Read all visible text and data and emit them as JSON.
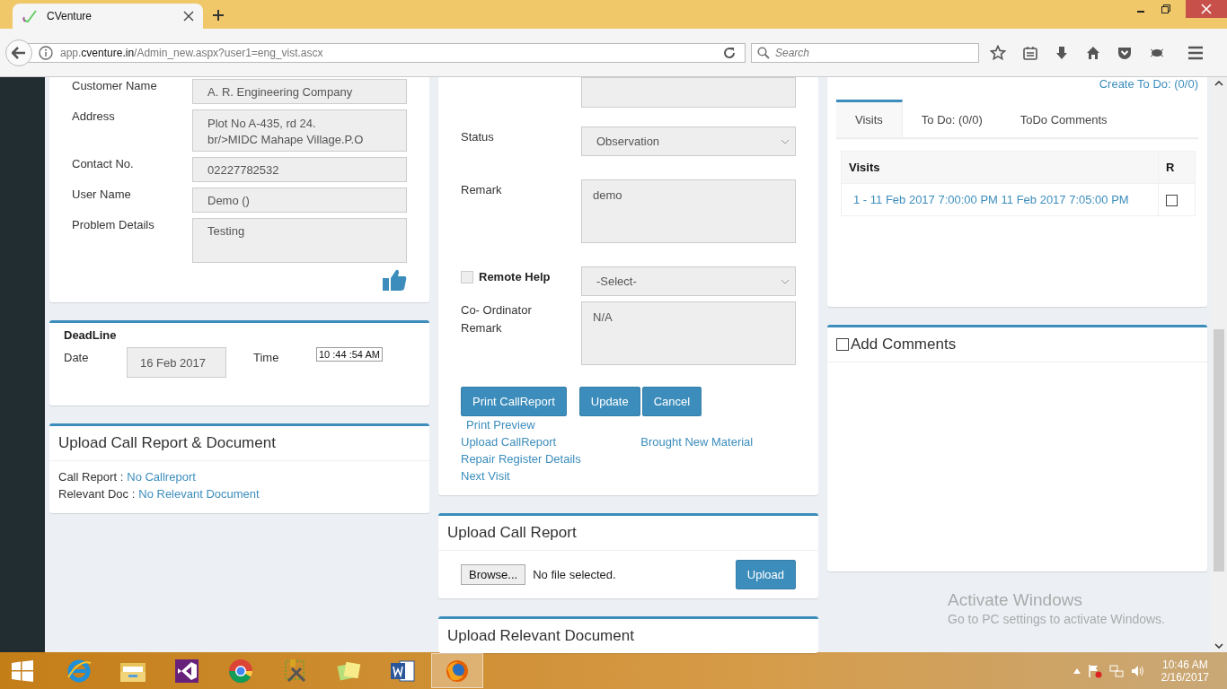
{
  "browser": {
    "tab_title": "CVenture",
    "url": {
      "prefix": "app.",
      "host": "cventure.in",
      "path": "/Admin_new.aspx?user1=eng_vist.ascx"
    },
    "search_placeholder": "Search"
  },
  "customer_card": {
    "fields": [
      {
        "kind": "input",
        "label": "Customer Name",
        "value": "A. R. Engineering Company"
      },
      {
        "kind": "scrolltext",
        "label": "Address",
        "lines": [
          "Plot No A-435, rd 24.",
          "br/>MIDC Mahape Village.P.O"
        ]
      },
      {
        "kind": "input",
        "label": "Contact No.",
        "value": "02227782532"
      },
      {
        "kind": "input",
        "label": "User Name",
        "value": "Demo ()"
      },
      {
        "kind": "textarea",
        "label": "Problem Details",
        "value": "Testing"
      }
    ]
  },
  "deadline": {
    "title": "DeadLine",
    "date_label": "Date",
    "date": "16 Feb 2017",
    "time_label": "Time",
    "time": "10 :44 :54  AM"
  },
  "upload_doc": {
    "title": "Upload Call Report & Document",
    "rows": [
      {
        "label": "Call Report :",
        "link": "No Callreport"
      },
      {
        "label": "Relevant Doc :",
        "link": "No Relevant Document"
      }
    ]
  },
  "visit_form": {
    "status_label": "Status",
    "status": "Observation",
    "remark_label": "Remark",
    "remark": "demo",
    "remote_help": {
      "label": "Remote Help",
      "checked": false
    },
    "remote_select": "-Select-",
    "coordinator_label": "Co- Ordinator Remark",
    "coordinator_remark": "N/A",
    "buttons": [
      "Print CallReport",
      "Update",
      "Cancel"
    ],
    "print_preview": "Print Preview",
    "upload_link": "Upload CallReport",
    "material_link": "Brought New Material",
    "repair_link": "Repair Register Details",
    "next_link": "Next Visit"
  },
  "upload_call_report": {
    "title": "Upload Call Report",
    "browse": "Browse...",
    "file_status": "No file selected.",
    "upload": "Upload"
  },
  "upload_relevant": {
    "title": "Upload Relevant Document"
  },
  "visits_card": {
    "create_todo": "Create To Do: (0/0)",
    "tabs": [
      {
        "label": "Visits",
        "selected": true
      },
      {
        "label": "To Do: (0/0)",
        "selected": false
      },
      {
        "label": "ToDo Comments",
        "selected": false
      }
    ],
    "columns": [
      "Visits",
      "R"
    ],
    "rows": [
      {
        "visit": "1 - 11 Feb 2017 7:00:00 PM 11 Feb 2017 7:05:00 PM",
        "checked": false
      }
    ]
  },
  "comments": {
    "label": "Add Comments",
    "checked": false
  },
  "activation": {
    "title": "Activate Windows",
    "subtitle": "Go to PC settings to activate Windows."
  },
  "taskbar": {
    "apps": [
      {
        "kind": "ie",
        "active": false
      },
      {
        "kind": "explorer",
        "active": false
      },
      {
        "kind": "studio",
        "active": false
      },
      {
        "kind": "chrome",
        "active": false
      },
      {
        "kind": "tools",
        "active": false
      },
      {
        "kind": "notes",
        "active": false
      },
      {
        "kind": "word",
        "active": false
      },
      {
        "kind": "firefox",
        "active": true
      }
    ],
    "time": "10:46 AM",
    "date": "2/16/2017"
  }
}
